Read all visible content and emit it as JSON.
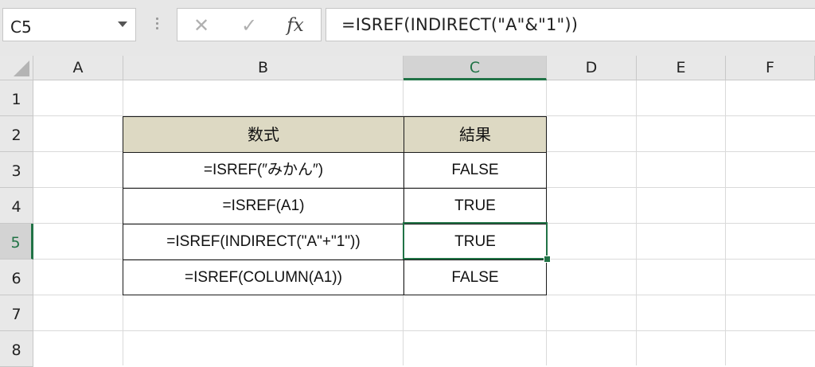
{
  "name_box": {
    "value": "C5"
  },
  "formula_bar": {
    "cancel_icon": "close-icon",
    "enter_icon": "check-icon",
    "fx_label": "fx",
    "formula": "=ISREF(INDIRECT(\"A\"&\"1\"))"
  },
  "columns": [
    "A",
    "B",
    "C",
    "D",
    "E",
    "F"
  ],
  "selected_column": "C",
  "rows": [
    "1",
    "2",
    "3",
    "4",
    "5",
    "6",
    "7",
    "8"
  ],
  "selected_row": "5",
  "table": {
    "headers": [
      "数式",
      "結果"
    ],
    "header_fill": "#ddd9c3",
    "rows": [
      {
        "formula": "=ISREF(″みかん″)",
        "result": "FALSE"
      },
      {
        "formula": "=ISREF(A1)",
        "result": "TRUE"
      },
      {
        "formula": "=ISREF(INDIRECT(\"A\"+\"1\"))",
        "result": "TRUE"
      },
      {
        "formula": "=ISREF(COLUMN(A1))",
        "result": "FALSE"
      }
    ]
  },
  "accent_color": "#217346"
}
